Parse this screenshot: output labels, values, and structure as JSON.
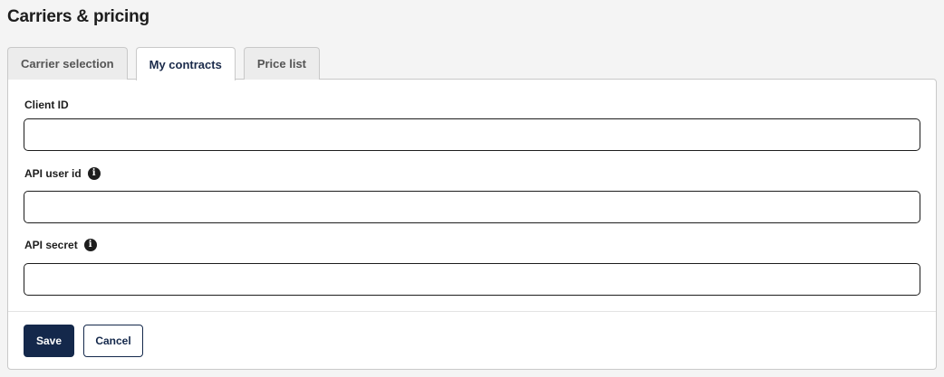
{
  "page": {
    "title": "Carriers & pricing"
  },
  "tabs": [
    {
      "label": "Carrier selection",
      "active": false
    },
    {
      "label": "My contracts",
      "active": true
    },
    {
      "label": "Price list",
      "active": false
    }
  ],
  "form": {
    "client_id": {
      "label": "Client ID",
      "value": "",
      "info_icon": false
    },
    "api_user_id": {
      "label": "API user id",
      "value": "",
      "info_icon": true,
      "icon": "info-icon"
    },
    "api_secret": {
      "label": "API secret",
      "value": "",
      "info_icon": true,
      "icon": "info-icon"
    }
  },
  "actions": {
    "save_label": "Save",
    "cancel_label": "Cancel"
  },
  "colors": {
    "primary": "#14284b",
    "border": "#c9c9c9",
    "background": "#f4f4f4"
  }
}
